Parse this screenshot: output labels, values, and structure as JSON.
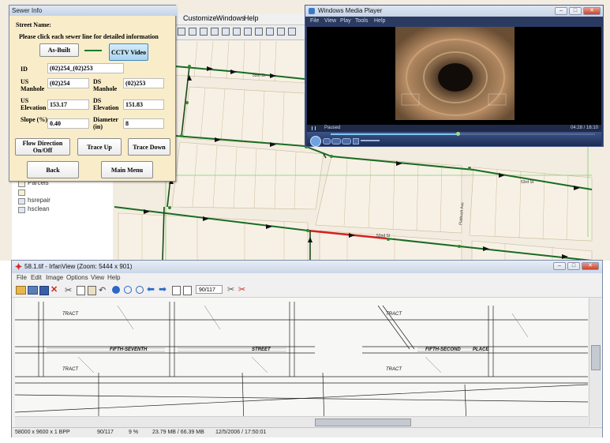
{
  "gis": {
    "menu": {
      "customize": "Customize",
      "windows": "Windows",
      "help": "Help"
    },
    "streets": {
      "st1": "55th St",
      "st2": "53rd St",
      "st3": "52nd St",
      "ave": "Flatbush Ave"
    },
    "layers": [
      "Parcels",
      "",
      "hsrepair",
      "hsclean"
    ]
  },
  "sewer": {
    "window_title": "Sewer Info",
    "street_name_label": "Street Name:",
    "instruction": "Please click each sewer line for detailed information",
    "as_built": "As-Built",
    "cctv": "CCTV Video",
    "id_label": "ID",
    "id_value": "(02)254_(02)253",
    "us_manhole_label": "US Manhole",
    "us_manhole_value": "(02)254",
    "ds_manhole_label": "DS Manhole",
    "ds_manhole_value": "(02)253",
    "us_elev_label": "US Elevation",
    "us_elev_value": "153.17",
    "ds_elev_label": "DS Elevation",
    "ds_elev_value": "151.83",
    "slope_label": "Slope (%)",
    "slope_value": "0.40",
    "diameter_label": "Diameter (in)",
    "diameter_value": "8",
    "flow_btn": "Flow Direction On/Off",
    "trace_up": "Trace Up",
    "trace_down": "Trace Down",
    "back": "Back",
    "main_menu": "Main Menu"
  },
  "wmp": {
    "title": "Windows Media Player",
    "menu": [
      "File",
      "View",
      "Play",
      "Tools",
      "Help"
    ],
    "status": "Paused",
    "time": "04:28 / 16:10",
    "progress": 0.48
  },
  "irfan": {
    "title": "58.1.tif - IrfanView (Zoom: 5444 x 901)",
    "menu": [
      "File",
      "Edit",
      "Image",
      "Options",
      "View",
      "Help"
    ],
    "page_field": "90/117",
    "status": {
      "dims": "58000 x 9600 x 1 BPP",
      "page": "90/117",
      "zoom": "9 %",
      "mem": "23.79 MB / 66.39 MB",
      "date": "12/5/2006 / 17:50:01"
    },
    "drawing_text": {
      "street1": "FIFTH-SEVENTH",
      "street1b": "STREET",
      "street2": "FIFTH-SECOND",
      "street2b": "PLACE",
      "tract": "TRACT"
    }
  }
}
